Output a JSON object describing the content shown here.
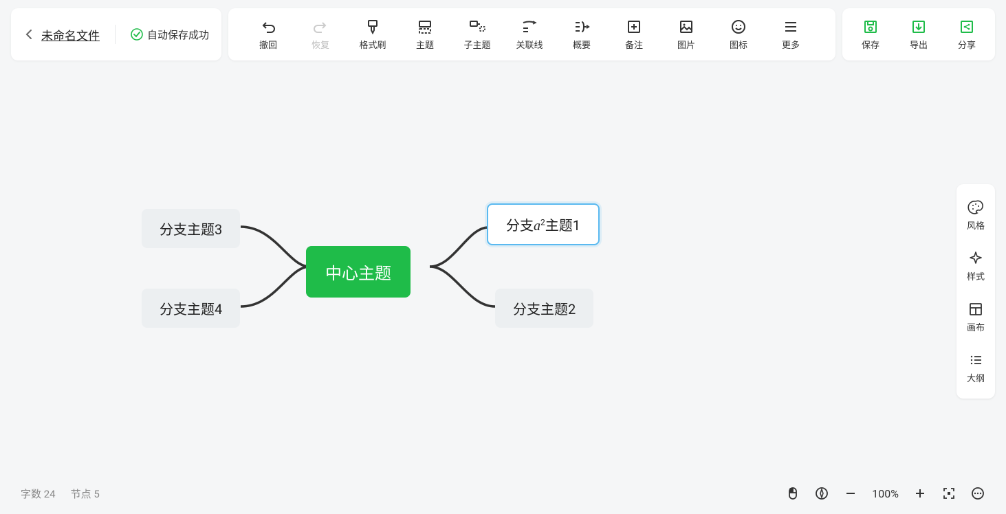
{
  "header": {
    "filename": "未命名文件",
    "autosave_label": "自动保存成功"
  },
  "toolbar": {
    "undo": "撤回",
    "redo": "恢复",
    "format_brush": "格式刷",
    "topic": "主题",
    "subtopic": "子主题",
    "relation": "关联线",
    "summary": "概要",
    "note": "备注",
    "image": "图片",
    "icon": "图标",
    "more": "更多"
  },
  "actions": {
    "save": "保存",
    "export": "导出",
    "share": "分享"
  },
  "sidepanel": {
    "style_theme": "风格",
    "style": "样式",
    "canvas": "画布",
    "outline": "大纲"
  },
  "mindmap": {
    "center": "中心主题",
    "branches": {
      "b1_pre": "分支",
      "b1_math": "a",
      "b1_sup": "2",
      "b1_post": "主题1",
      "b2": "分支主题2",
      "b3": "分支主题3",
      "b4": "分支主题4"
    }
  },
  "status": {
    "word_label": "字数",
    "word_count": "24",
    "node_label": "节点",
    "node_count": "5",
    "zoom": "100%"
  }
}
